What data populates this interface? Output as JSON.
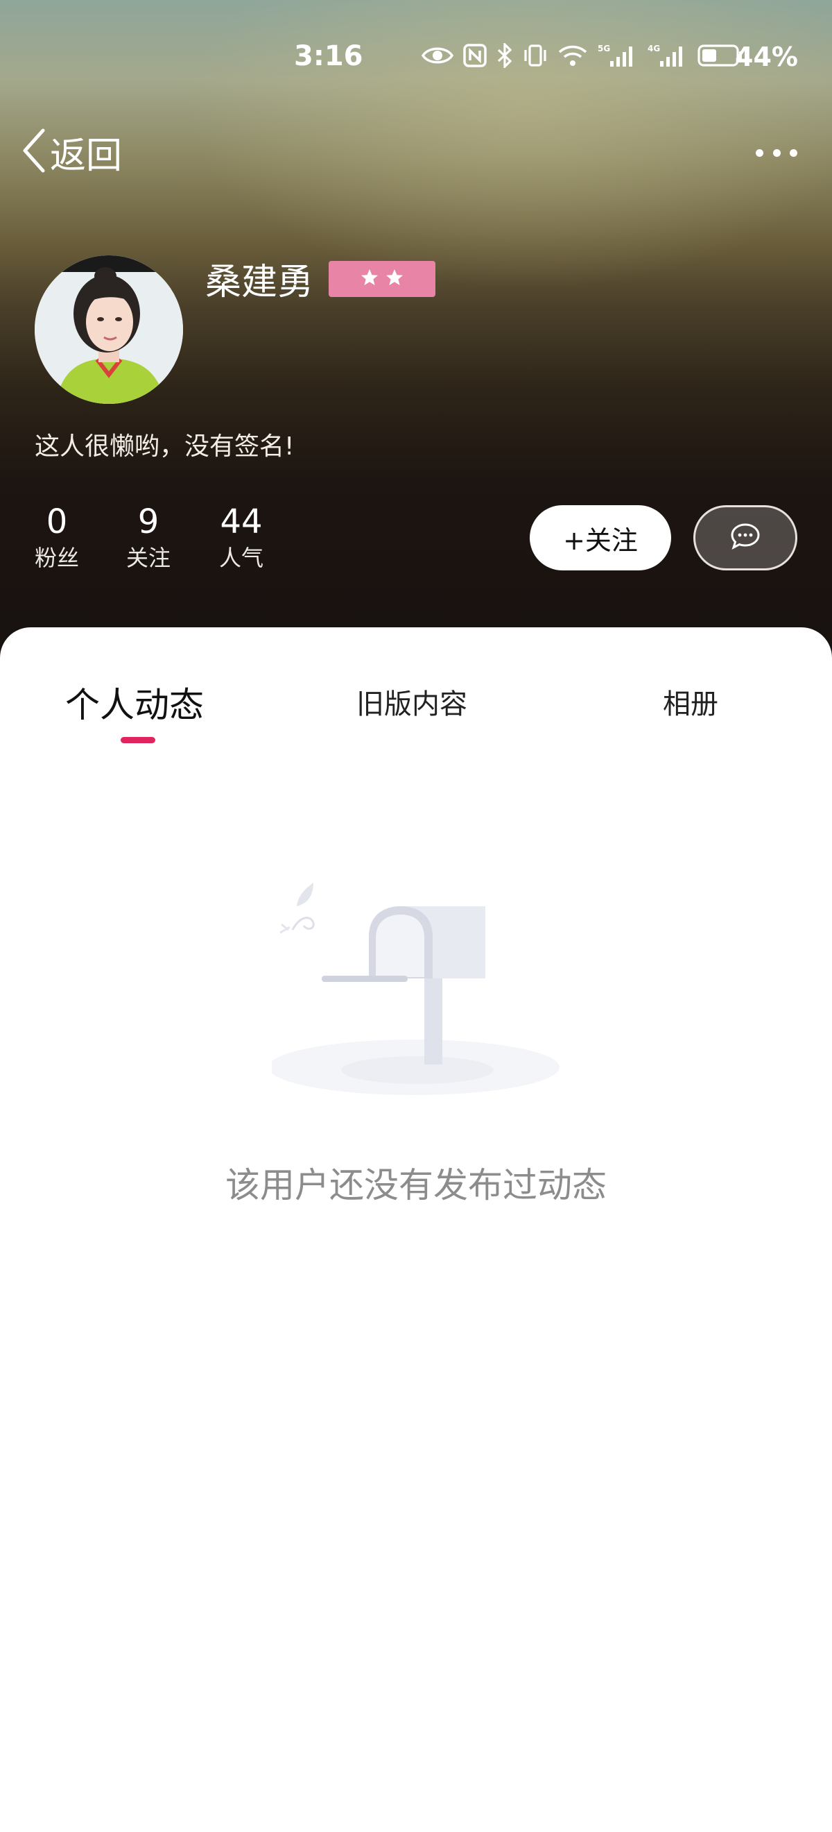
{
  "status_bar": {
    "time": "3:16",
    "battery_percent": "44%",
    "battery_level": 0.44,
    "network_1": "5G",
    "network_2": "4G",
    "icons": [
      "eye-icon",
      "nfc-icon",
      "bluetooth-icon",
      "vibrate-icon",
      "wifi-icon",
      "signal-5g-icon",
      "signal-4g-icon",
      "battery-icon"
    ]
  },
  "nav": {
    "back_label": "返回",
    "more_icon": "more-dots-icon"
  },
  "profile": {
    "name": "桑建勇",
    "level_stars": 2,
    "level_badge_color": "#e884a6",
    "signature": "这人很懒哟，没有签名!",
    "stats": [
      {
        "value": "0",
        "label": "粉丝"
      },
      {
        "value": "9",
        "label": "关注"
      },
      {
        "value": "44",
        "label": "人气"
      }
    ],
    "follow_label": "+关注",
    "message_icon": "chat-bubble-icon"
  },
  "tabs": [
    {
      "label": "个人动态",
      "active": true
    },
    {
      "label": "旧版内容",
      "active": false
    },
    {
      "label": "相册",
      "active": false
    }
  ],
  "accent_color": "#e0245e",
  "empty_state": {
    "icon": "mailbox-icon",
    "text": "该用户还没有发布过动态"
  }
}
